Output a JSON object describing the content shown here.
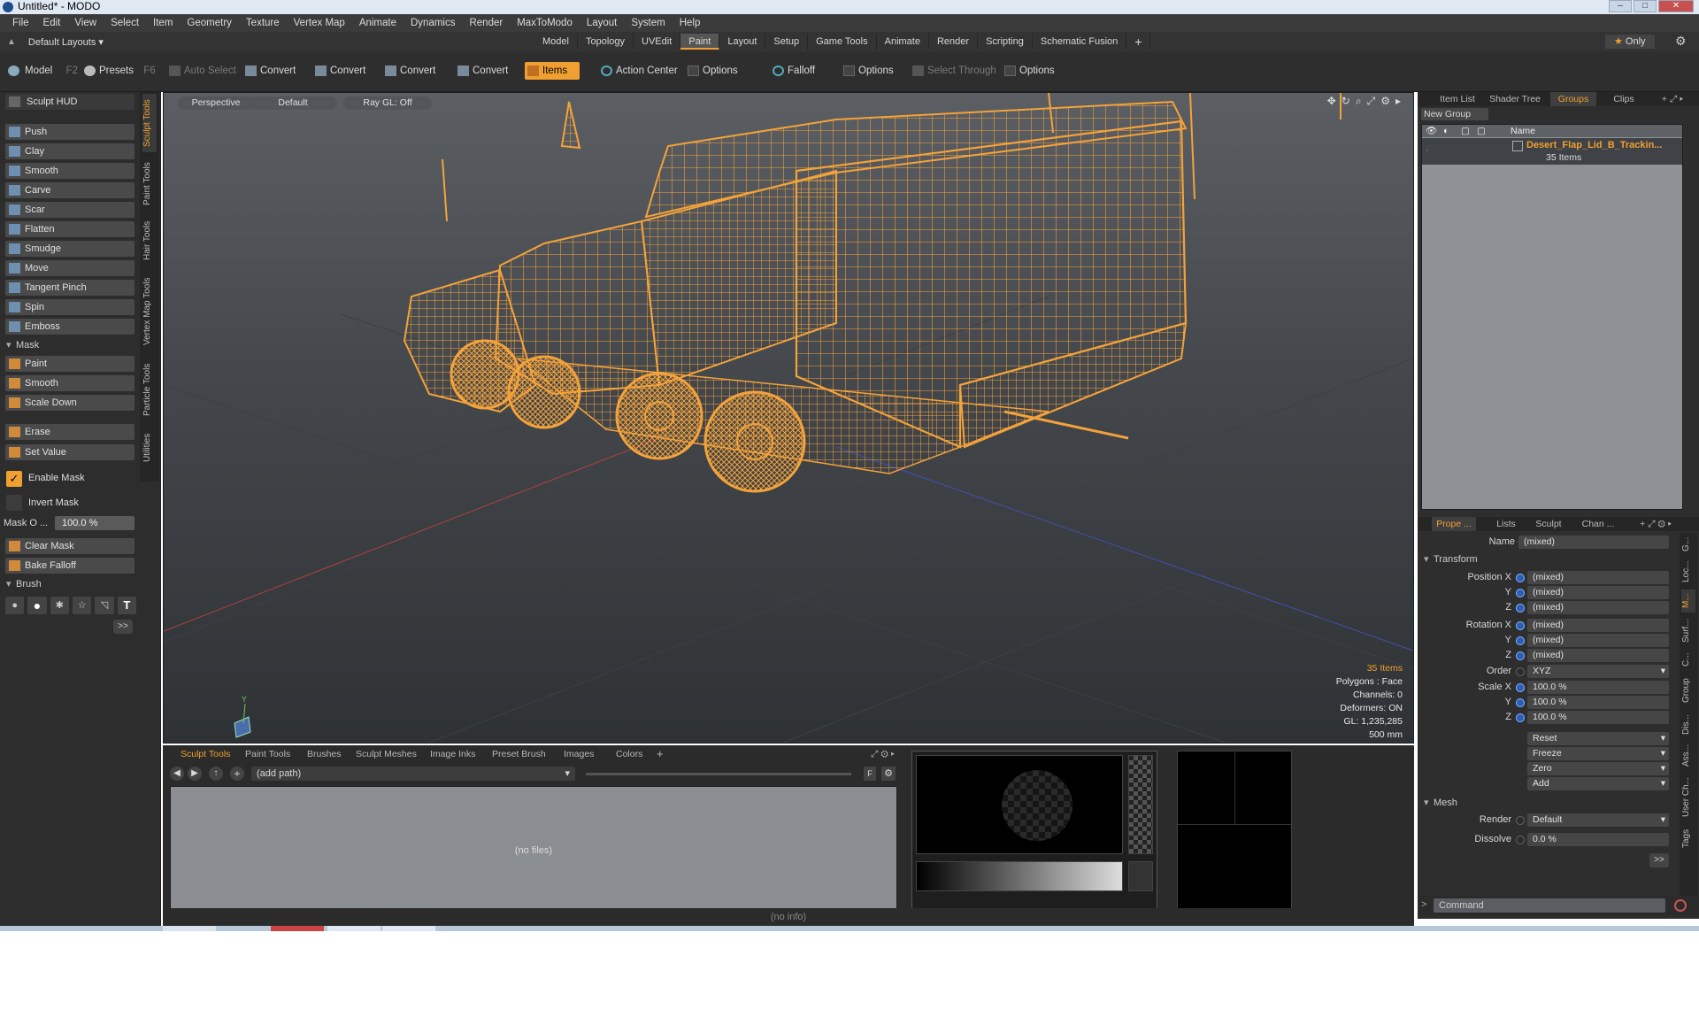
{
  "window": {
    "title": "Untitled* - MODO"
  },
  "menu": [
    "File",
    "Edit",
    "View",
    "Select",
    "Item",
    "Geometry",
    "Texture",
    "Vertex Map",
    "Animate",
    "Dynamics",
    "Render",
    "MaxToModo",
    "Layout",
    "System",
    "Help"
  ],
  "layouts": {
    "label": "Default Layouts",
    "tabs": [
      "Model",
      "Topology",
      "UVEdit",
      "Paint",
      "Layout",
      "Setup",
      "Game Tools",
      "Animate",
      "Render",
      "Scripting",
      "Schematic Fusion"
    ],
    "active": "Paint",
    "add": "+",
    "only": "Only"
  },
  "toolbar": {
    "model": "Model",
    "model_key": "F2",
    "presets": "Presets",
    "presets_key": "F6",
    "auto_select": "Auto Select",
    "convert": "Convert",
    "items": "Items",
    "action_center": "Action Center",
    "options": "Options",
    "falloff": "Falloff",
    "select_through": "Select Through"
  },
  "left": {
    "sculpt_hud": "Sculpt HUD",
    "tools": [
      "Push",
      "Clay",
      "Smooth",
      "Carve",
      "Scar",
      "Flatten",
      "Smudge",
      "Move",
      "Tangent Pinch",
      "Spin",
      "Emboss"
    ],
    "mask_header": "Mask",
    "mask_tools": [
      "Paint",
      "Smooth",
      "Scale Down"
    ],
    "erase": "Erase",
    "set_value": "Set Value",
    "enable_mask": "Enable Mask",
    "invert_mask": "Invert Mask",
    "mask_opacity_label": "Mask O ...",
    "mask_opacity_value": "100.0 %",
    "clear_mask": "Clear Mask",
    "bake_falloff": "Bake Falloff",
    "brush_header": "Brush",
    "more": ">>",
    "vtabs": [
      "Sculpt Tools",
      "Paint Tools",
      "Hair Tools",
      "Vertex Map Tools",
      "Particle Tools",
      "Utilities"
    ]
  },
  "viewport": {
    "view": "Perspective",
    "style": "Default",
    "raygl": "Ray GL: Off",
    "axis_y": "Y",
    "stats": {
      "items": "35 Items",
      "polygons": "Polygons : Face",
      "channels": "Channels: 0",
      "deformers": "Deformers: ON",
      "gl": "GL: 1,235,285",
      "scale": "500 mm"
    }
  },
  "right_top": {
    "tabs": [
      "Item List",
      "Shader Tree",
      "Groups",
      "Clips"
    ],
    "active": "Groups",
    "new_group": "New Group",
    "col_name": "Name",
    "group_name": "Desert_Flap_Lid_B_Trackin...",
    "group_count": "35 Items"
  },
  "properties": {
    "tabs": [
      "Prope ...",
      "Lists",
      "Sculpt",
      "Chan ..."
    ],
    "name_label": "Name",
    "name_value": "(mixed)",
    "transform": "Transform",
    "pos_label": "Position X",
    "rot_label": "Rotation X",
    "scale_label": "Scale X",
    "y": "Y",
    "z": "Z",
    "mixed": "(mixed)",
    "order_label": "Order",
    "order_value": "XYZ",
    "scale_value": "100.0 %",
    "reset": "Reset",
    "freeze": "Freeze",
    "zero": "Zero",
    "add": "Add",
    "mesh": "Mesh",
    "render_label": "Render",
    "render_value": "Default",
    "dissolve_label": "Dissolve",
    "dissolve_value": "0.0 %",
    "more": ">>",
    "vtabs": [
      "G...",
      "Loc...",
      "M...",
      "Surf...",
      "C...",
      "Group",
      "Dis...",
      "Ass...",
      "User Ch...",
      "Tags"
    ]
  },
  "bottom": {
    "tabs": [
      "Sculpt Tools",
      "Paint Tools",
      "Brushes",
      "Sculpt Meshes",
      "Image Inks",
      "Preset Brush",
      "Images",
      "Colors"
    ],
    "path": "(add path)",
    "nofiles": "(no files)",
    "info": "(no info)",
    "command": "Command",
    "f": "F"
  },
  "colors": {
    "accent": "#f0a030",
    "wire": "#f4a23a"
  }
}
